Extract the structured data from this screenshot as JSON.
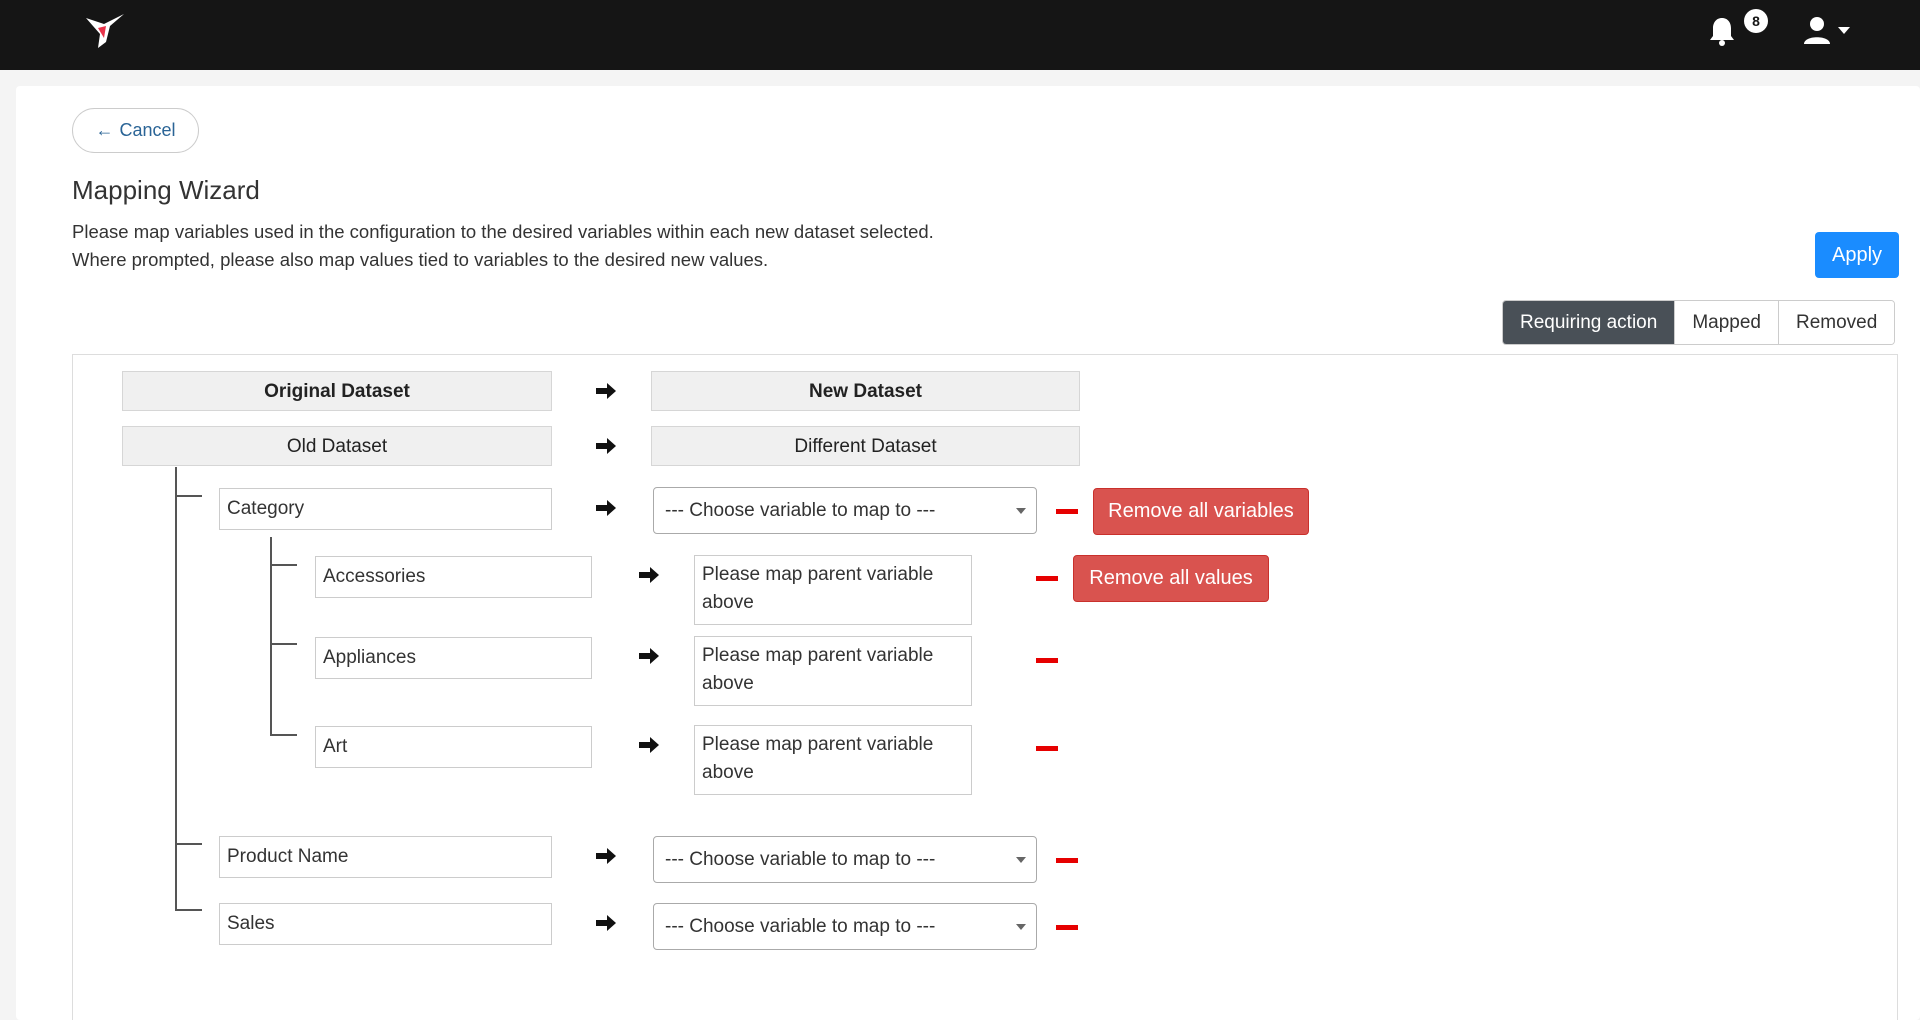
{
  "header": {
    "notification_count": "8"
  },
  "nav": {
    "cancel_label": "Cancel"
  },
  "page": {
    "title": "Mapping Wizard",
    "description_line1": "Please map variables used in the configuration to the desired variables within each new dataset selected.",
    "description_line2": "Where prompted, please also map values tied to variables to the desired new values.",
    "apply_label": "Apply"
  },
  "tabs": {
    "requiring": "Requiring action",
    "mapped": "Mapped",
    "removed": "Removed"
  },
  "mapping": {
    "original_header": "Original Dataset",
    "new_header": "New Dataset",
    "old_dataset": "Old Dataset",
    "new_dataset": "Different Dataset",
    "select_placeholder": "--- Choose variable to map to ---",
    "remove_all_variables": "Remove all variables",
    "remove_all_values": "Remove all values",
    "variables": {
      "category": "Category",
      "product_name": "Product Name",
      "sales": "Sales"
    },
    "values": {
      "accessories": "Accessories",
      "appliances": "Appliances",
      "art": "Art"
    },
    "value_prompt": "Please map parent variable above"
  },
  "colors": {
    "topbar": "#151515",
    "primary": "#1a8cff",
    "danger": "#d9534f",
    "remove_minus": "#e60000",
    "tab_active": "#495057"
  }
}
